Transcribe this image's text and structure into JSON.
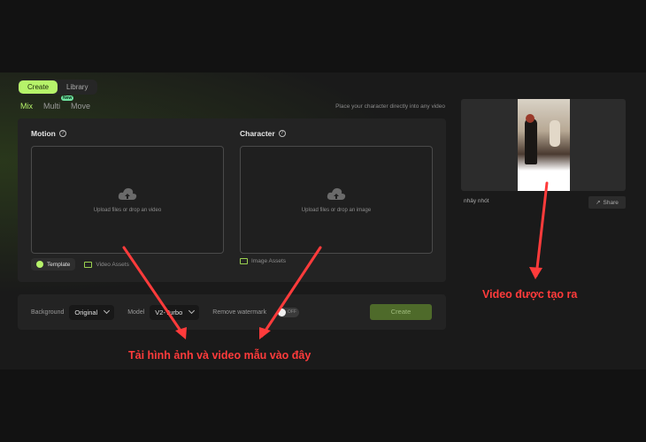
{
  "tabs": {
    "create": "Create",
    "library": "Library"
  },
  "modes": {
    "mix": "Mix",
    "multi": "Multi",
    "multi_badge": "New",
    "move": "Move"
  },
  "hint": "Place your character directly into any video",
  "motion": {
    "title": "Motion",
    "drop_text": "Upload files or drop an video",
    "template_label": "Template",
    "assets_label": "Video Assets"
  },
  "character": {
    "title": "Character",
    "drop_text": "Upload files or drop an image",
    "assets_label": "Image Assets"
  },
  "settings": {
    "background_label": "Background",
    "background_value": "Original",
    "model_label": "Model",
    "model_value": "V2-Turbo",
    "watermark_label": "Remove watermark",
    "watermark_state": "OFF",
    "create_label": "Create"
  },
  "preview": {
    "caption": "nhảy nhót",
    "share_label": "Share"
  },
  "annotations": {
    "upload_note": "Tải hình ảnh và video mẫu vào đây",
    "output_note": "Video được tạo ra",
    "color": "#ff3b3b"
  },
  "colors": {
    "accent": "#b6f36a",
    "background": "#121212",
    "panel": "#232323"
  }
}
